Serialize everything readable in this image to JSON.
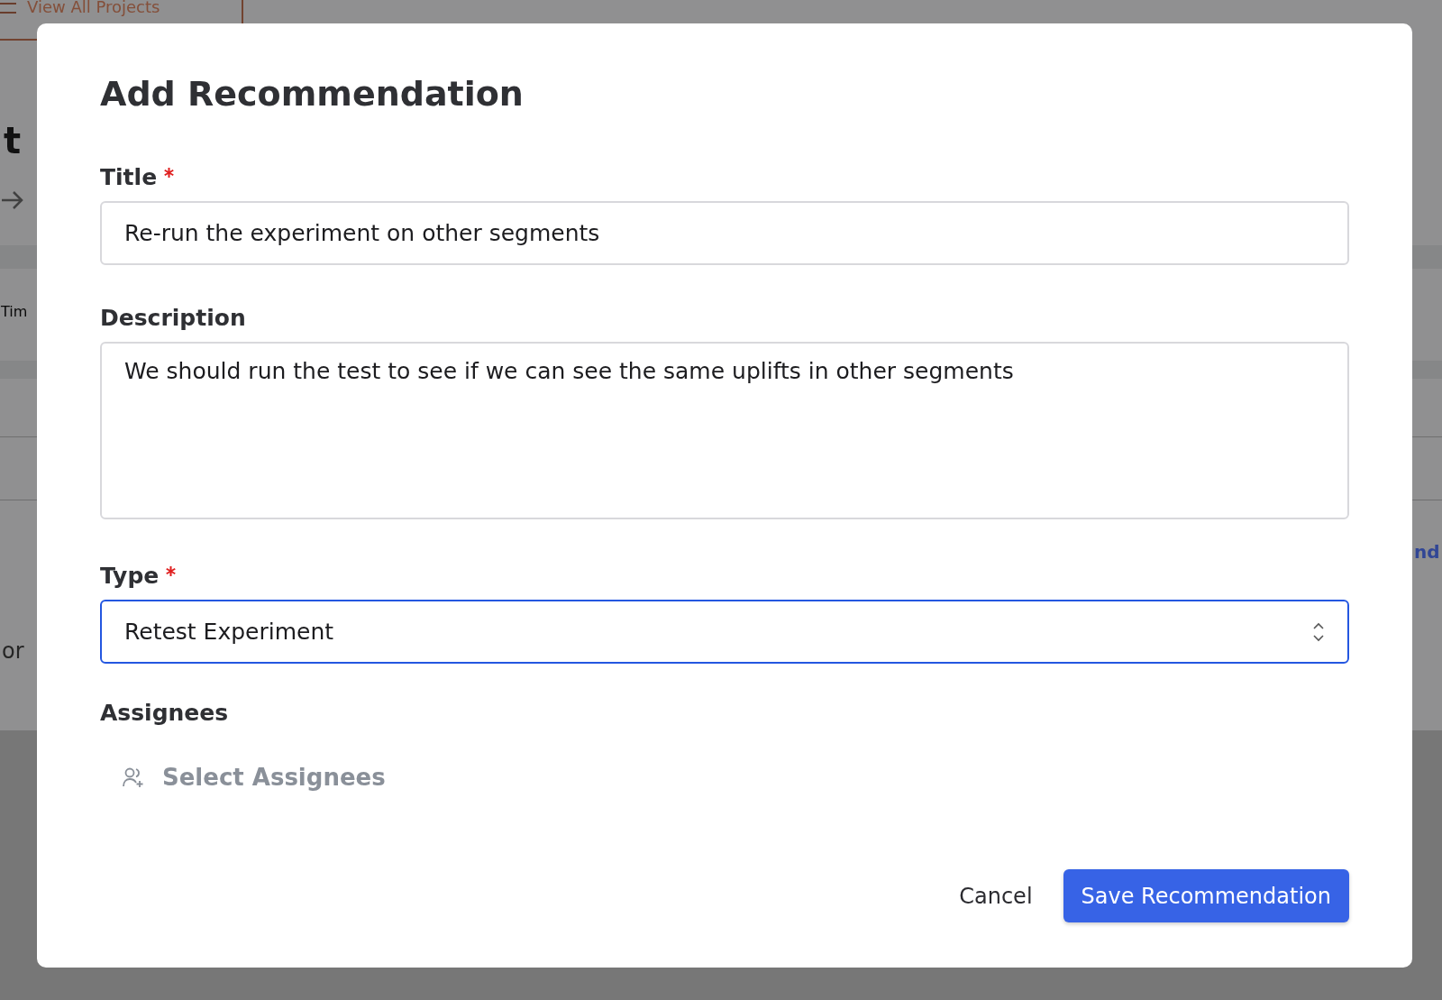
{
  "background": {
    "nav_link": "View All Projects",
    "heading_fragment": "t",
    "column_fragment": "Tim",
    "text_fragment": "or",
    "link_fragment": "nd"
  },
  "dialog": {
    "title": "Add Recommendation",
    "fields": [
      {
        "kind": "text",
        "label": "Title",
        "required": true,
        "value": "Re-run the experiment on other segments",
        "focused": false
      },
      {
        "kind": "textarea",
        "label": "Description",
        "required": false,
        "value": "We should run the test to see if we can see the same uplifts in other segments",
        "focused": false
      },
      {
        "kind": "select",
        "label": "Type",
        "required": true,
        "value": "Retest Experiment",
        "focused": true
      },
      {
        "kind": "assignees",
        "label": "Assignees",
        "required": false,
        "placeholder": "Select Assignees"
      }
    ],
    "buttons": [
      {
        "kind": "secondary",
        "label": "Cancel"
      },
      {
        "kind": "primary",
        "label": "Save Recommendation"
      }
    ]
  }
}
